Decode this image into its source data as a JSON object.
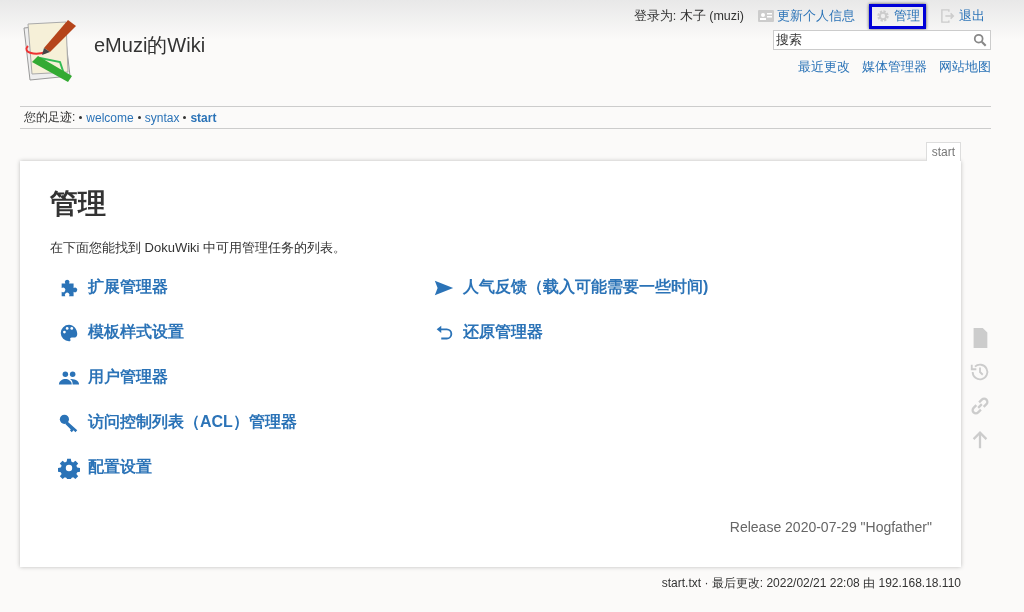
{
  "header": {
    "site_title": "eMuzi的Wiki",
    "logged_in": "登录为: 木子 (muzi)",
    "user_tools": [
      {
        "label": "更新个人信息",
        "highlighted": false
      },
      {
        "label": "管理",
        "highlighted": true
      },
      {
        "label": "退出",
        "highlighted": false
      }
    ],
    "search": {
      "placeholder": "搜索"
    },
    "site_tools": [
      "最近更改",
      "媒体管理器",
      "网站地图"
    ]
  },
  "breadcrumbs": {
    "label": "您的足迹:",
    "items": [
      {
        "label": "welcome",
        "current": false
      },
      {
        "label": "syntax",
        "current": false
      },
      {
        "label": "start",
        "current": true
      }
    ]
  },
  "page_tab": "start",
  "content": {
    "title": "管理",
    "intro": "在下面您能找到 DokuWiki 中可用管理任务的列表。",
    "admin_columns": [
      [
        {
          "label": "扩展管理器"
        },
        {
          "label": "模板样式设置"
        },
        {
          "label": "用户管理器"
        },
        {
          "label": "访问控制列表（ACL）管理器"
        },
        {
          "label": "配置设置"
        }
      ],
      [
        {
          "label": "人气反馈（载入可能需要一些时间)"
        },
        {
          "label": "还原管理器"
        }
      ]
    ],
    "release": "Release 2020-07-29 \"Hogfather\""
  },
  "footer": "start.txt · 最后更改: 2022/02/21 22:08 由 192.168.18.110"
}
